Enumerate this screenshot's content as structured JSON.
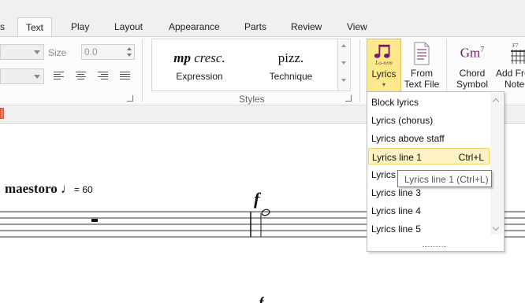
{
  "tabs": [
    "s",
    "Text",
    "Play",
    "Layout",
    "Appearance",
    "Parts",
    "Review",
    "View"
  ],
  "active_tab": "Text",
  "text_group": {
    "size_label": "Size",
    "size_value": "0.0"
  },
  "styles_gallery": {
    "items": [
      {
        "display_bold": "mp",
        "display_italic": "cresc.",
        "label": "Expression"
      },
      {
        "display": "pizz.",
        "label": "Technique"
      }
    ],
    "group_label": "Styles"
  },
  "ribbon_buttons": {
    "lyrics": {
      "label": "Lyrics",
      "icon_text": "Lo-rem"
    },
    "from_text_file": {
      "line1": "From",
      "line2": "Text File"
    },
    "chord_symbol": {
      "line1": "Chord",
      "line2": "Symbol",
      "icon_text": "Gm",
      "icon_sup": "7"
    },
    "add_fretboard": {
      "line1": "Add Fre",
      "line2": "Note",
      "icon_sup": "F7"
    }
  },
  "lyrics_menu": {
    "items": [
      {
        "label": "Block lyrics",
        "shortcut": ""
      },
      {
        "label": "Lyrics (chorus)",
        "shortcut": ""
      },
      {
        "label": "Lyrics above staff",
        "shortcut": ""
      },
      {
        "label": "Lyrics line 1",
        "shortcut": "Ctrl+L"
      },
      {
        "label": "Lyrics l",
        "shortcut": ""
      },
      {
        "label": "Lyrics line 3",
        "shortcut": ""
      },
      {
        "label": "Lyrics line 4",
        "shortcut": ""
      },
      {
        "label": "Lyrics line 5",
        "shortcut": ""
      }
    ],
    "highlighted_index": 3
  },
  "tooltip": "Lyrics line 1 (Ctrl+L)",
  "score": {
    "tempo_text": "maestoro",
    "tempo_note": "♩",
    "tempo_value": "= 60",
    "dynamic": "f",
    "dynamic_2": "f"
  },
  "colors": {
    "pressed_button": "#fde88b",
    "menu_highlight": "#fdf2c4",
    "lyrics_icon": "#7a1a6e"
  }
}
